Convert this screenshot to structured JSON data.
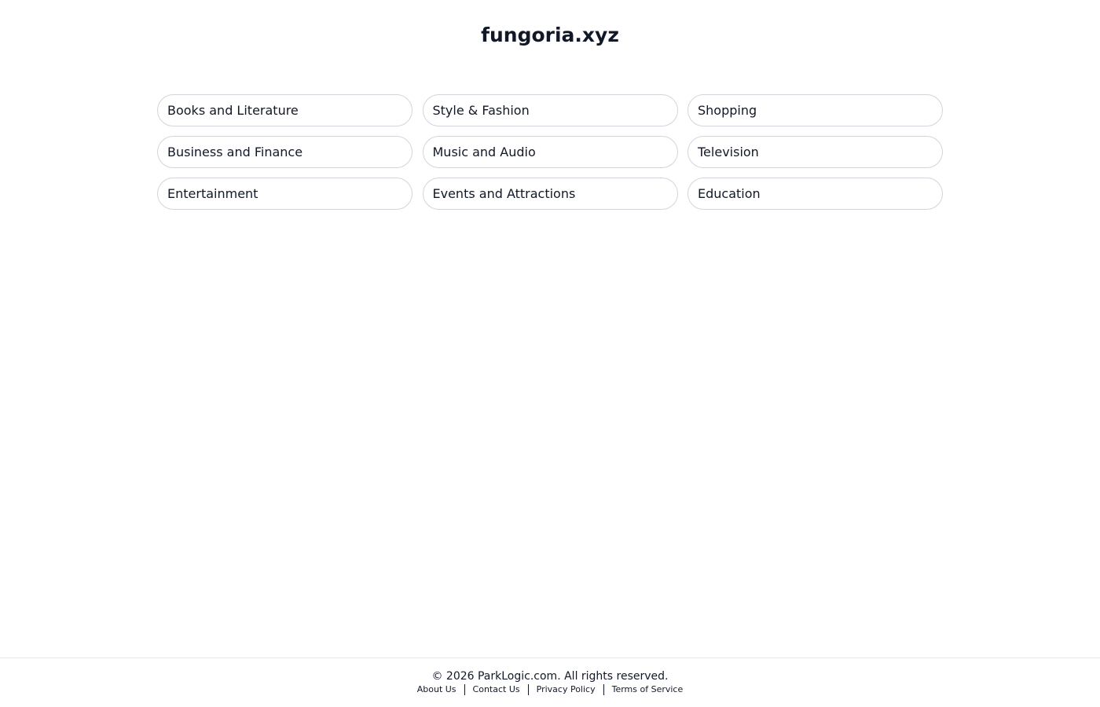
{
  "header": {
    "title": "fungoria.xyz"
  },
  "categories": [
    {
      "label": "Books and Literature"
    },
    {
      "label": "Style & Fashion"
    },
    {
      "label": "Shopping"
    },
    {
      "label": "Business and Finance"
    },
    {
      "label": "Music and Audio"
    },
    {
      "label": "Television"
    },
    {
      "label": "Entertainment"
    },
    {
      "label": "Events and Attractions"
    },
    {
      "label": "Education"
    }
  ],
  "footer": {
    "copyright": "© 2026 ParkLogic.com. All rights reserved.",
    "links": [
      {
        "label": "About Us"
      },
      {
        "label": "Contact Us"
      },
      {
        "label": "Privacy Policy"
      },
      {
        "label": "Terms of Service"
      }
    ]
  },
  "colors": {
    "text": "#111827",
    "pill_border": "#d1d5db",
    "footer_border": "#e5e7eb",
    "background": "#ffffff"
  }
}
